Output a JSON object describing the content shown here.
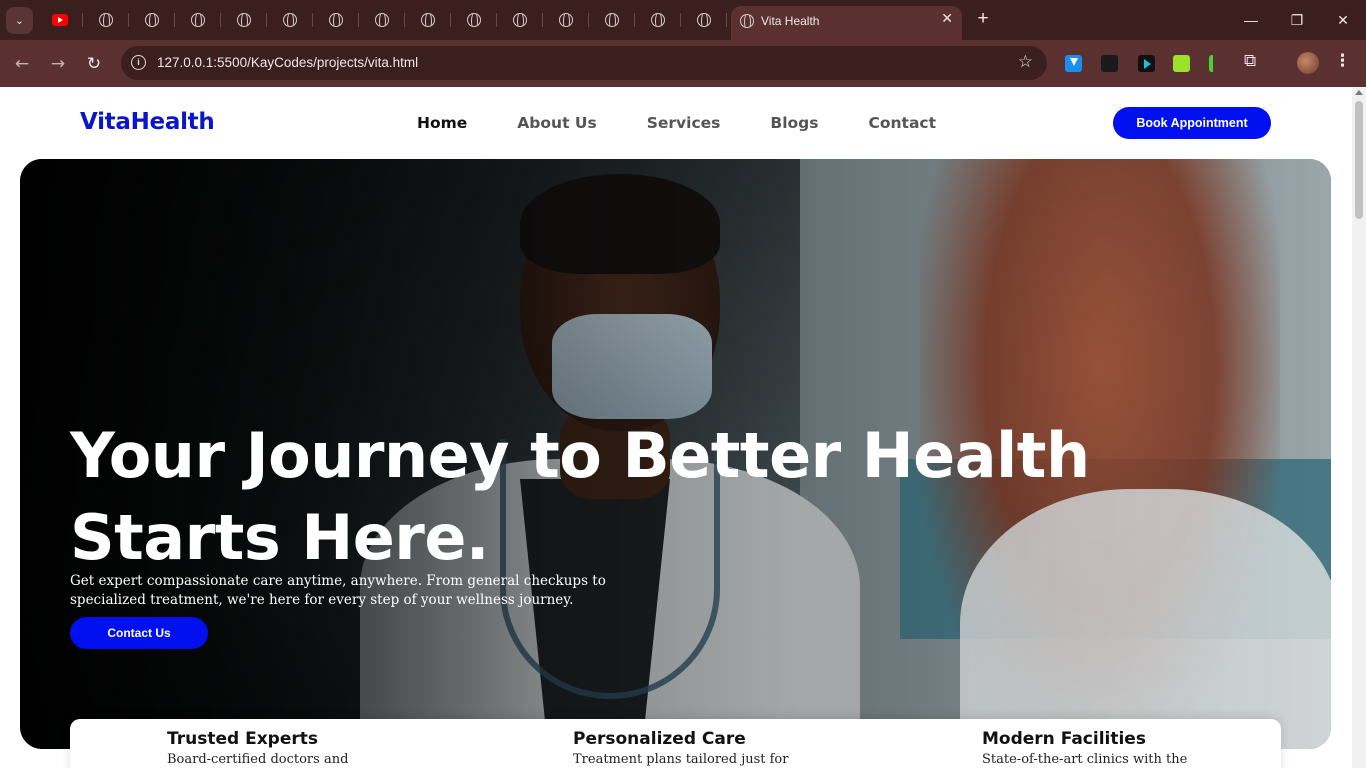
{
  "browser": {
    "tab_title": "Vita Health",
    "url": "127.0.0.1:5500/KayCodes/projects/vita.html",
    "new_tab": "+",
    "close": "✕",
    "minimize": "—",
    "restore": "❐",
    "window_close": "✕",
    "back": "←",
    "forward": "→",
    "reload": "↻",
    "star": "☆",
    "info": "i",
    "puzzle": "⧉",
    "kebab": "⋮",
    "menu": "⌄"
  },
  "site": {
    "logo": "VitaHealth",
    "nav": {
      "home": "Home",
      "about": "About Us",
      "services": "Services",
      "blogs": "Blogs",
      "contact": "Contact"
    },
    "book_button": "Book Appointment"
  },
  "hero": {
    "title": "Your Journey to Better Health Starts Here.",
    "subtitle": "Get expert compassionate care anytime, anywhere. From general checkups to specialized treatment, we're here for every step of your wellness journey.",
    "cta": "Contact Us"
  },
  "features": [
    {
      "title": "Trusted Experts",
      "desc": "Board-certified doctors and"
    },
    {
      "title": "Personalized Care",
      "desc": "Treatment plans tailored just for"
    },
    {
      "title": "Modern Facilities",
      "desc": "State-of-the-art clinics with the"
    }
  ],
  "colors": {
    "brand": "#0b16c9",
    "button": "#0010f0",
    "chrome_dark": "#3b1f1f",
    "chrome_toolbar": "#5a3030"
  }
}
